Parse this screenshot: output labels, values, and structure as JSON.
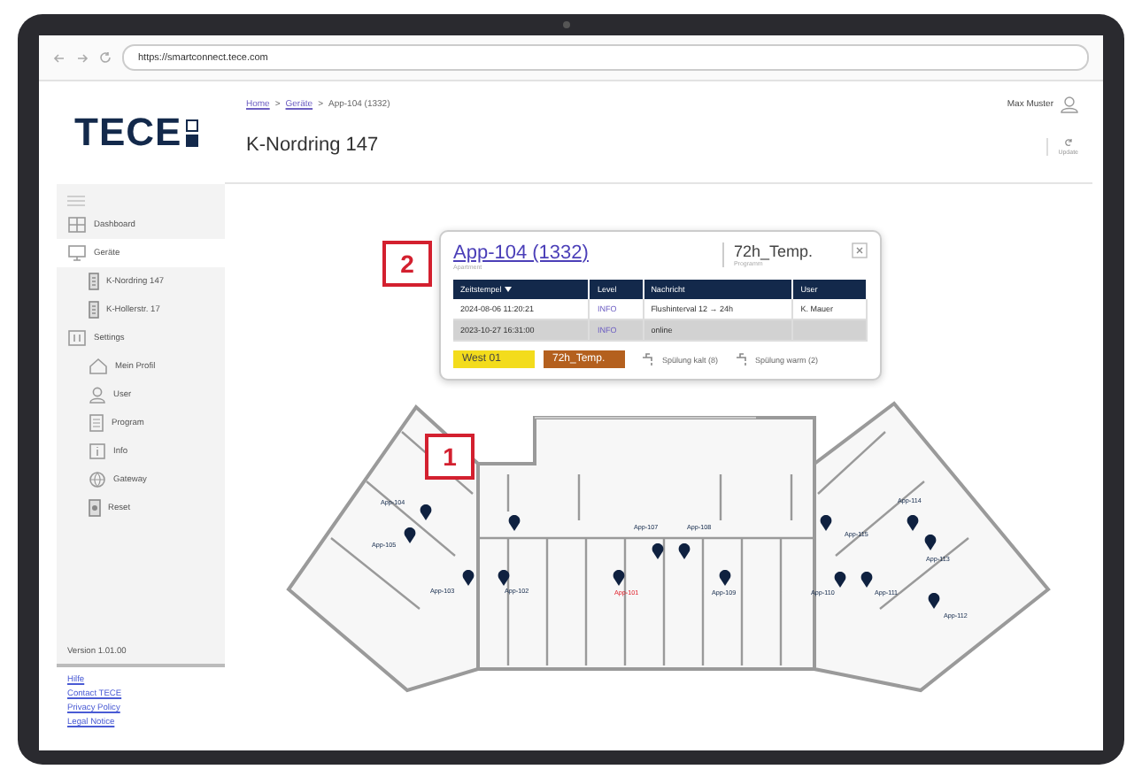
{
  "browser": {
    "url": "https://smartconnect.tece.com"
  },
  "logo": {
    "text": "TECE"
  },
  "header": {
    "breadcrumb": [
      {
        "label": "Home",
        "link": true
      },
      {
        "label": "Geräte",
        "link": true
      },
      {
        "label": "App-104 (1332)",
        "link": false
      }
    ],
    "separator": ">",
    "title": "K-Nordring 147",
    "user": "Max Muster",
    "update_label": "Update"
  },
  "sidebar": {
    "items": [
      {
        "label": "Dashboard",
        "selected": false
      },
      {
        "label": "Geräte",
        "selected": true,
        "children": [
          {
            "label": "K-Nordring 147",
            "selected": false
          },
          {
            "label": "K-Hollerstr. 17",
            "selected": false
          }
        ]
      },
      {
        "label": "Settings",
        "selected": false,
        "children": [
          {
            "label": "Mein Profil",
            "selected": false
          },
          {
            "label": "User",
            "selected": false
          },
          {
            "label": "Program",
            "selected": false
          },
          {
            "label": "Info",
            "selected": false
          },
          {
            "label": "Gateway",
            "selected": false
          },
          {
            "label": "Reset",
            "selected": false
          }
        ]
      }
    ],
    "version": "Version 1.01.00",
    "links": [
      "Hilfe",
      "Contact TECE",
      "Privacy Policy",
      "Legal Notice"
    ]
  },
  "popup": {
    "title": "App-104 (1332)",
    "subtitle": "Apartment",
    "program": "72h_Temp.",
    "program_caption": "Programm",
    "columns": [
      {
        "label": "Zeitstempel",
        "sorted": true
      },
      {
        "label": "Level",
        "sorted": false
      },
      {
        "label": "Nachricht",
        "sorted": false
      },
      {
        "label": "User",
        "sorted": false
      }
    ],
    "rows": [
      {
        "cells": [
          "2024-08-06  11:20:21",
          "INFO",
          "Flushinterval 12 → 24h",
          "K. Mauer"
        ],
        "selected": false
      },
      {
        "cells": [
          "2023-10-27  16:31:00",
          "INFO",
          "online"
        ],
        "selected": true
      }
    ],
    "tags": [
      {
        "label": "West 01",
        "color": "#f3dc1c"
      },
      {
        "label": "72h_Temp.",
        "color": "#b4601e"
      }
    ],
    "flushes": [
      "Spülung kalt (8)",
      "Spülung warm (2)"
    ]
  },
  "map": {
    "pins": [
      {
        "label": "App-104",
        "alert": false
      },
      {
        "label": "App-105",
        "alert": false
      },
      {
        "label": "App-103",
        "alert": false
      },
      {
        "label": "App-102",
        "alert": false
      },
      {
        "label": "App-101",
        "alert": true
      },
      {
        "label": "App-107",
        "alert": false
      },
      {
        "label": "App-108",
        "alert": false
      },
      {
        "label": "App-109",
        "alert": false
      },
      {
        "label": "App-115",
        "alert": false
      },
      {
        "label": "App-114",
        "alert": false
      },
      {
        "label": "App-113",
        "alert": false
      },
      {
        "label": "App-112",
        "alert": false
      },
      {
        "label": "App-110",
        "alert": false
      },
      {
        "label": "App-111",
        "alert": false
      }
    ]
  },
  "callouts": [
    {
      "number": "1"
    },
    {
      "number": "2"
    }
  ]
}
